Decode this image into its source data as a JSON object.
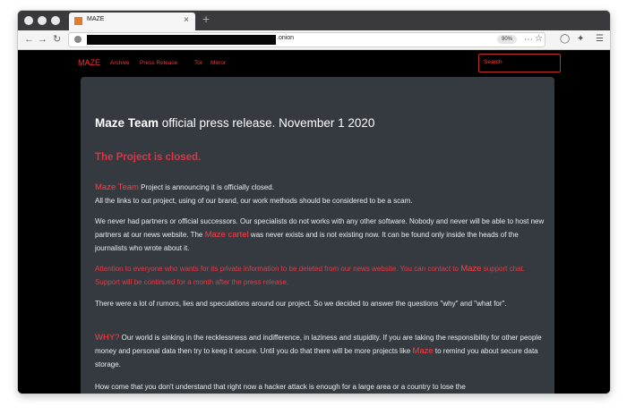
{
  "browser": {
    "tab_title": "MAZE",
    "tab_close": "×",
    "new_tab": "+",
    "url": ".onion",
    "zoom": "90%",
    "icons": [
      "back-arrow-icon",
      "forward-arrow-icon",
      "reload-icon",
      "page-info-icon",
      "more-actions-icon",
      "bookmark-star-icon",
      "shield-icon",
      "extension-icon",
      "hamburger-menu-icon"
    ]
  },
  "site": {
    "brand": "MAZE",
    "nav": [
      "Archive",
      "Press Release",
      "Tor",
      "Mirror"
    ],
    "search_placeholder": "Search"
  },
  "article": {
    "headline_bold": "Maze Team",
    "headline_rest": " official press release. November 1 2020",
    "status": "The Project is closed.",
    "p1_hl": "Maze Team",
    "p1_a": " Project is announcing it is officially closed.",
    "p1_b": "All the links to out project, using of our brand, our work methods should be considered to be a scam.",
    "p2_a": "We never had partners or official successors. Our specialists do not works with any other software. Nobody and never will be able to host new partners at our news website. The ",
    "p2_hl": "Maze cartel",
    "p2_b": " was never exists and is not existing now. It can be found only inside the heads of the journalists who wrote about it.",
    "p3_a": "Attention to everyone who wants for its private information to be deleted from our news website. You can contact to ",
    "p3_hl": "Maze",
    "p3_b": " support chat. Support will be continued for a month after the press release.",
    "p4": "There were a lot of rumors, lies and speculations around our project. So we decided to answer the questions \"why\" and \"what for\".",
    "p5_hl": "WHY?",
    "p5_a": " Our world is sinking in the recklessness and indifference, in laziness and stupidity. If you are taking the responsibility for other people money and personal data then try to keep it secure. Until you do that there will be more projects like ",
    "p5_hl2": "Maze",
    "p5_b": " to remind you about secure data storage.",
    "p6": "How come that you don't understand that right now a hacker attack is enough for a large area or a country to lose the"
  },
  "colors": {
    "accent": "#dc3545",
    "panel": "#343a40",
    "page_bg": "#000000"
  }
}
